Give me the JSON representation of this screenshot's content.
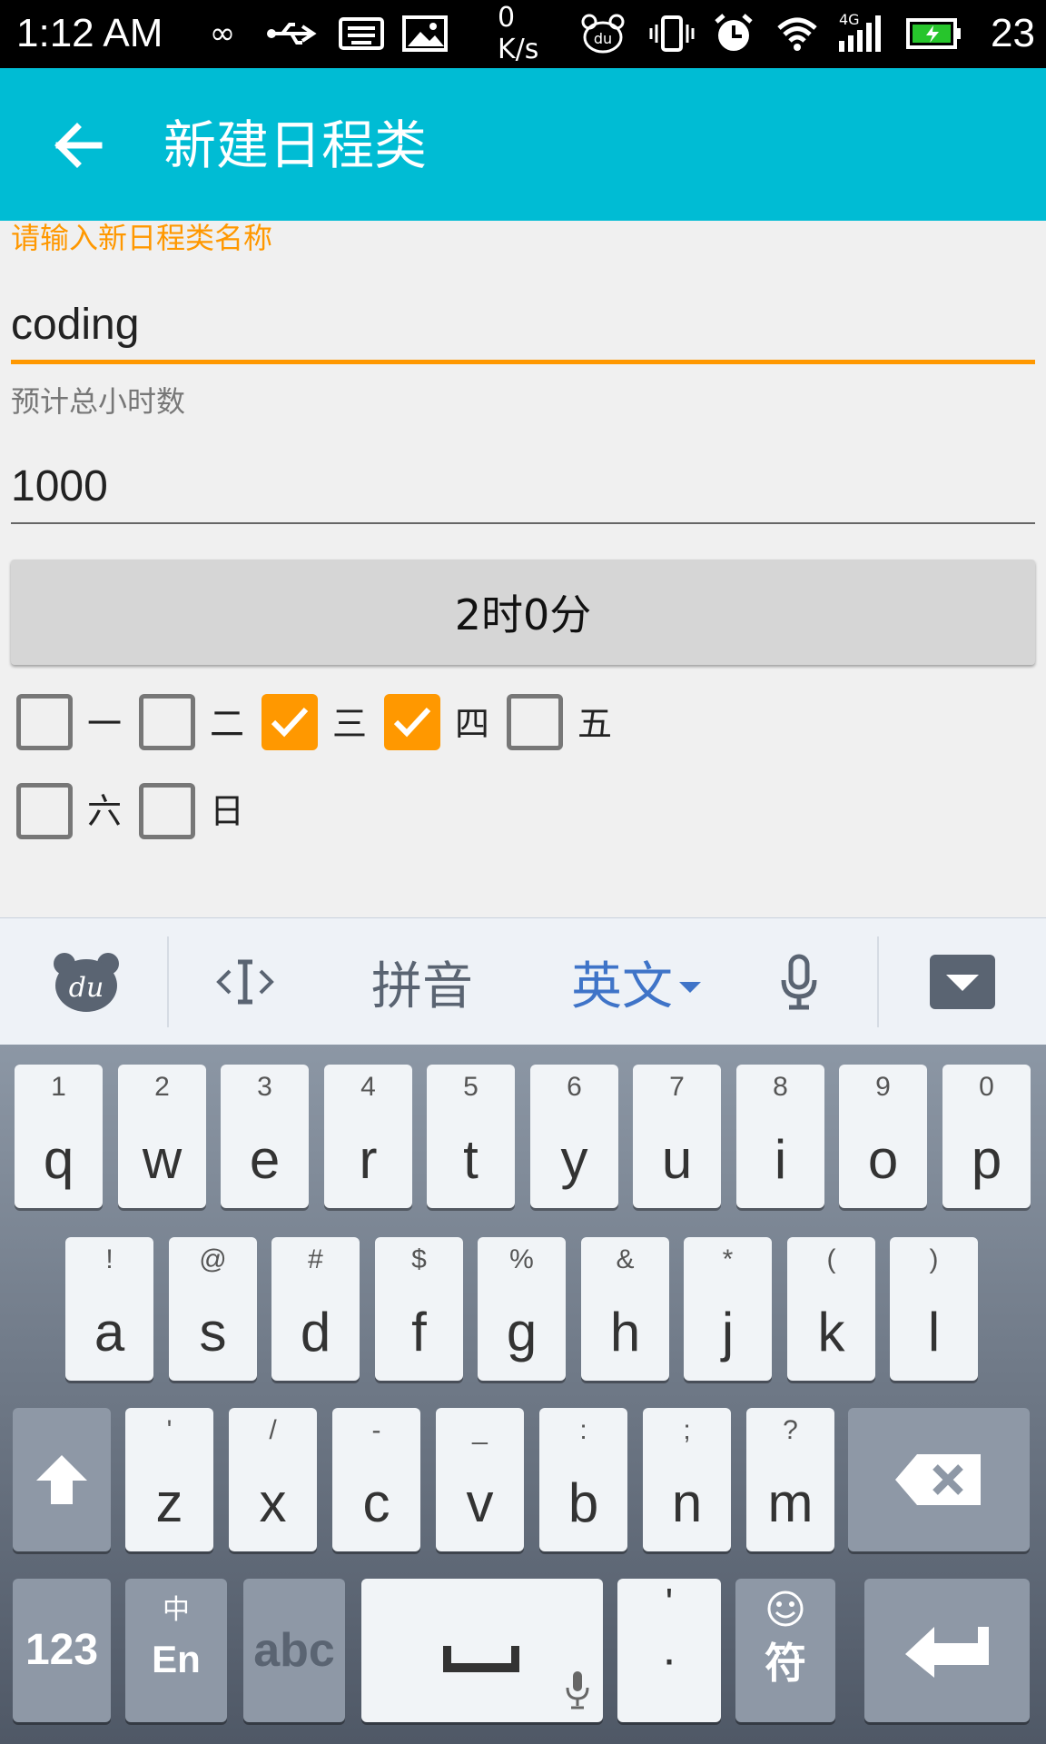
{
  "status_bar": {
    "time": "1:12 AM",
    "speed": "0 K/s",
    "network": "4G",
    "battery": "23"
  },
  "toolbar": {
    "title": "新建日程类"
  },
  "form": {
    "name_label": "请输入新日程类名称",
    "name_value": "coding",
    "hours_label": "预计总小时数",
    "hours_value": "1000",
    "time_button": "2时0分",
    "days": [
      {
        "label": "一",
        "checked": false
      },
      {
        "label": "二",
        "checked": false
      },
      {
        "label": "三",
        "checked": true
      },
      {
        "label": "四",
        "checked": true
      },
      {
        "label": "五",
        "checked": false
      },
      {
        "label": "六",
        "checked": false
      },
      {
        "label": "日",
        "checked": false
      }
    ]
  },
  "keyboard": {
    "ime_bar": {
      "cursor_icon": "<|>",
      "pinyin": "拼音",
      "english": "英文"
    },
    "row1": [
      {
        "main": "q",
        "sub": "1"
      },
      {
        "main": "w",
        "sub": "2"
      },
      {
        "main": "e",
        "sub": "3"
      },
      {
        "main": "r",
        "sub": "4"
      },
      {
        "main": "t",
        "sub": "5"
      },
      {
        "main": "y",
        "sub": "6"
      },
      {
        "main": "u",
        "sub": "7"
      },
      {
        "main": "i",
        "sub": "8"
      },
      {
        "main": "o",
        "sub": "9"
      },
      {
        "main": "p",
        "sub": "0"
      }
    ],
    "row2": [
      {
        "main": "a",
        "sub": "!"
      },
      {
        "main": "s",
        "sub": "@"
      },
      {
        "main": "d",
        "sub": "#"
      },
      {
        "main": "f",
        "sub": "$"
      },
      {
        "main": "g",
        "sub": "%"
      },
      {
        "main": "h",
        "sub": "&"
      },
      {
        "main": "j",
        "sub": "*"
      },
      {
        "main": "k",
        "sub": "("
      },
      {
        "main": "l",
        "sub": ")"
      }
    ],
    "row3": [
      {
        "main": "z",
        "sub": "'"
      },
      {
        "main": "x",
        "sub": "/"
      },
      {
        "main": "c",
        "sub": "-"
      },
      {
        "main": "v",
        "sub": "_"
      },
      {
        "main": "b",
        "sub": ":"
      },
      {
        "main": "n",
        "sub": ";"
      },
      {
        "main": "m",
        "sub": "?"
      }
    ],
    "bottom": {
      "num": "123",
      "lang_top": "中",
      "lang_bottom": "En",
      "abc": "abc",
      "comma": "'",
      "period": "·",
      "symbol": "符"
    }
  }
}
